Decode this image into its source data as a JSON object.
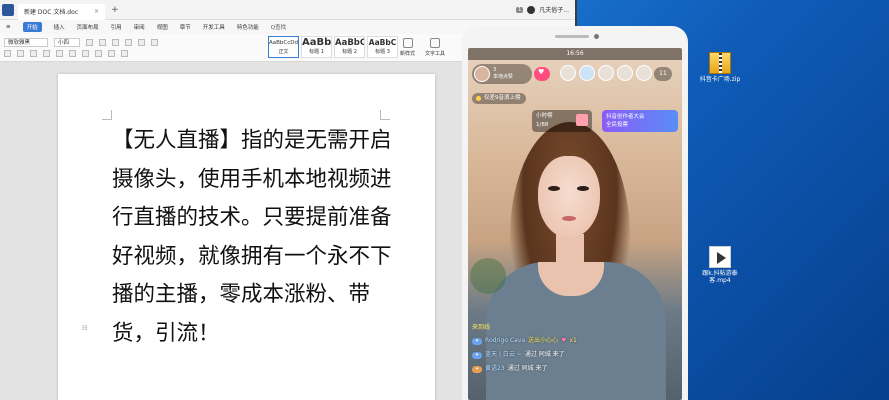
{
  "desktop": {
    "icons": [
      {
        "label": "抖音卡广场.zip",
        "type": "zip"
      },
      {
        "label": "跟k.抖帖游泰客.mp4",
        "type": "mp4",
        "badge": "MP4"
      }
    ]
  },
  "word": {
    "tab_title": "新建 DOC 文档.doc",
    "tab_close": "×",
    "tab_add": "+",
    "title_badge": "1",
    "title_user": "凡夫俗子...",
    "menu": [
      "≡",
      "开始",
      "插入",
      "页面布局",
      "引用",
      "审阅",
      "视图",
      "章节",
      "开发工具",
      "特色功能",
      "Q查找"
    ],
    "active_menu": "开始",
    "ribbon": {
      "font_name": "微软雅黑",
      "font_size": "小四",
      "styles": [
        {
          "preview": "AaBbCcDd",
          "name": "正文"
        },
        {
          "preview": "AaBb",
          "name": "标题 1"
        },
        {
          "preview": "AaBbC",
          "name": "标题 2"
        },
        {
          "preview": "AaBbC",
          "name": "标题 3"
        }
      ],
      "tools": [
        "新样式",
        "文字工具"
      ]
    },
    "document": {
      "body": "【无人直播】指的是无需开启摄像头，使用手机本地视频进行直播的技术。只要提前准备好视频，就像拥有一个永不下播的主播，零成本涨粉、带货，引流！",
      "para_mark": "⊟"
    }
  },
  "phone": {
    "status_time": "16:56",
    "host": {
      "name": "3",
      "subtitle": "本地点赞"
    },
    "viewer_count": "11",
    "rank_text": "仅差9音浪上榜",
    "task": {
      "line1": "小时榜",
      "line2": "1/88"
    },
    "banner": {
      "line1": "抖音创作者大会",
      "line2": "全民投票"
    },
    "chat": {
      "first_line": "来到线",
      "lines": [
        {
          "level": "",
          "user": "Rodrigo Cava",
          "msg": "送出小心心",
          "extra": "x1",
          "gift": true
        },
        {
          "level": "",
          "user": "蓝天 | 白云 ~",
          "msg": "通过 同城 来了"
        },
        {
          "level": "",
          "user": "黄语23",
          "msg": "通过 同城 来了"
        }
      ]
    }
  }
}
